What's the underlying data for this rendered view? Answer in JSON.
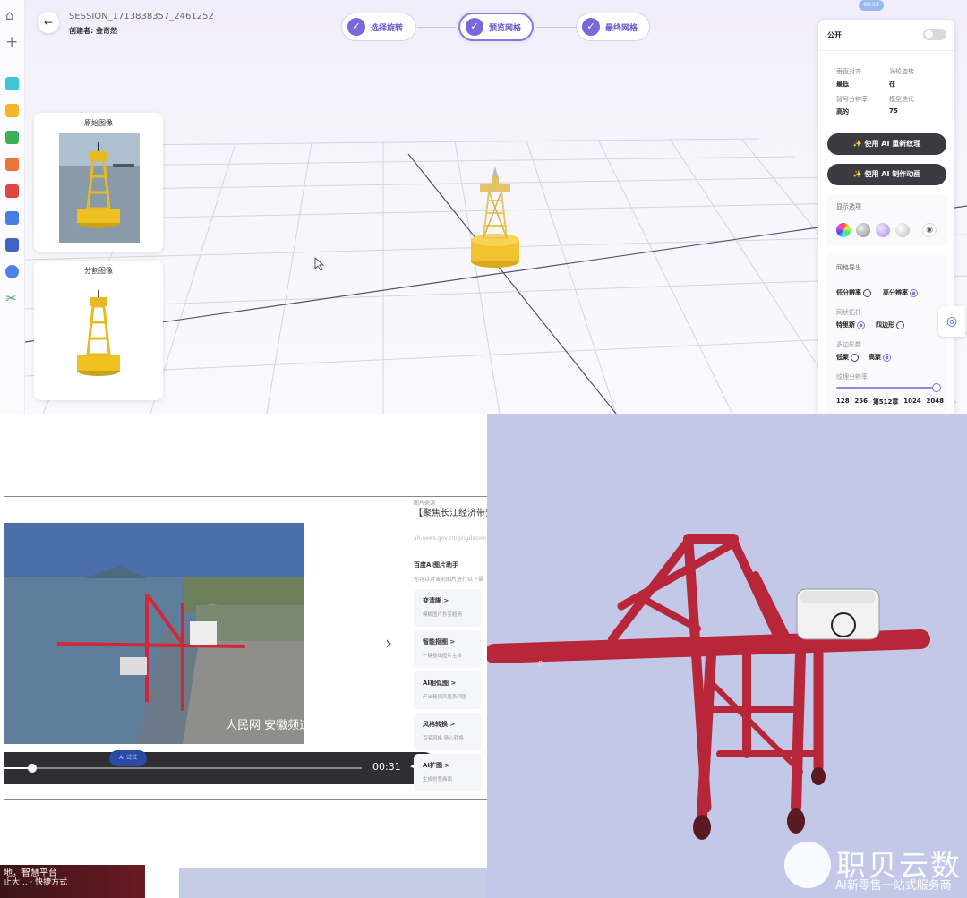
{
  "top_app": {
    "session_id": "SESSION_1713838357_2461252",
    "creator": "创建者: 金奇然",
    "back_icon": "arrow-left-icon",
    "steps": [
      {
        "label": "选择旋转",
        "state": "done"
      },
      {
        "label": "预览网格",
        "state": "active"
      },
      {
        "label": "最终网格",
        "state": "done"
      }
    ],
    "original_image_title": "原始图像",
    "segmented_image_title": "分割图像",
    "right_panel": {
      "public_label": "公开",
      "public_on": false,
      "props": [
        {
          "key": "垂直对齐",
          "value": "最低"
        },
        {
          "key": "涡轮旋转",
          "value": "在"
        },
        {
          "key": "智号分辨率",
          "value": "高的"
        },
        {
          "key": "模型迭代",
          "value": "75"
        }
      ],
      "retexture_button": "使用 AI 重新纹理",
      "animate_button": "使用 AI 制作动画",
      "display_options_label": "显示选项",
      "mesh_export_label": "网格导出",
      "resolution_options": [
        {
          "label": "低分辨率",
          "selected": false
        },
        {
          "label": "高分辨率",
          "selected": true
        }
      ],
      "topology_label": "网状拓扑",
      "topology_options": [
        {
          "label": "特里斯",
          "selected": true
        },
        {
          "label": "四边形",
          "selected": false
        }
      ],
      "polycount_label": "多边形数",
      "polycount_options": [
        {
          "label": "低聚",
          "selected": false
        },
        {
          "label": "高聚",
          "selected": true
        }
      ],
      "texture_resolution_label": "纹理分辨率",
      "texture_resolution_ticks": [
        "128",
        "256",
        "第512章",
        "1024",
        "2048"
      ],
      "texture_resolution_value": 1.0
    },
    "badge": "08:03"
  },
  "browser": {
    "source_label": "图片来源",
    "title": "【聚焦长江经济带安徽 波正当时】-长江经济",
    "url": "ah.news.gov.cn/qingdaoxing",
    "ai_helper_title": "百度AI图片助手",
    "ai_helper_sub": "你可以对当前图片进行以下操",
    "ai_cards": [
      {
        "title": "变清晰 >",
        "sub": "模糊图片秒变超清"
      },
      {
        "title": "智能抠图 >",
        "sub": "一键抠出图片主体"
      },
      {
        "title": "AI相似图 >",
        "sub": "产出精同风格系列图"
      },
      {
        "title": "风格转换 >",
        "sub": "百变风格 随心转换"
      },
      {
        "title": "AI扩图 >",
        "sub": "生成创意画面"
      }
    ],
    "video_time": "00:31",
    "video_progress": 0.08,
    "ai_chip": "AI 试试",
    "watermark_text": "人民网 安徽频道",
    "taskbar_line1": "地，智慧平台",
    "taskbar_line2": "止大...  · 快捷方式"
  },
  "render": {
    "watermark_name": "职贝云数",
    "watermark_slogan": "AI新零售一站式服务商"
  },
  "colors": {
    "accent": "#7b67d9",
    "crane_red": "#c8283a",
    "buoy_yellow": "#f2c230",
    "render_bg": "#c3c8e8"
  }
}
